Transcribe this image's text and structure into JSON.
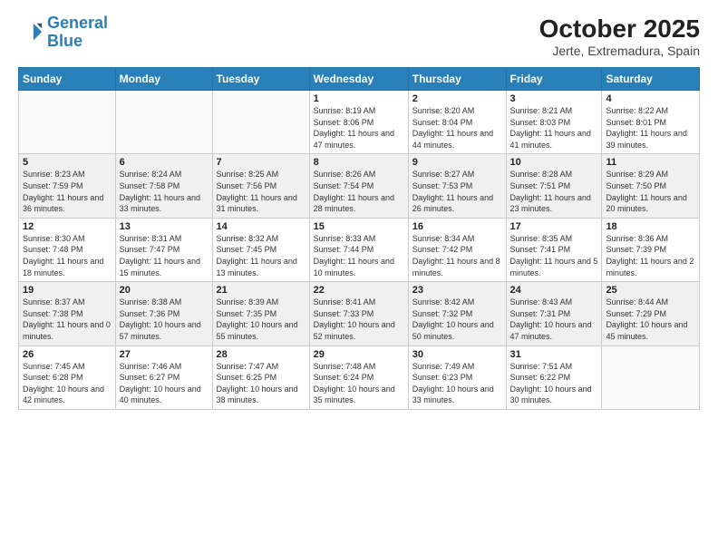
{
  "header": {
    "logo_line1": "General",
    "logo_line2": "Blue",
    "title": "October 2025",
    "subtitle": "Jerte, Extremadura, Spain"
  },
  "weekdays": [
    "Sunday",
    "Monday",
    "Tuesday",
    "Wednesday",
    "Thursday",
    "Friday",
    "Saturday"
  ],
  "weeks": [
    [
      {
        "day": "",
        "info": ""
      },
      {
        "day": "",
        "info": ""
      },
      {
        "day": "",
        "info": ""
      },
      {
        "day": "1",
        "info": "Sunrise: 8:19 AM\nSunset: 8:06 PM\nDaylight: 11 hours and 47 minutes."
      },
      {
        "day": "2",
        "info": "Sunrise: 8:20 AM\nSunset: 8:04 PM\nDaylight: 11 hours and 44 minutes."
      },
      {
        "day": "3",
        "info": "Sunrise: 8:21 AM\nSunset: 8:03 PM\nDaylight: 11 hours and 41 minutes."
      },
      {
        "day": "4",
        "info": "Sunrise: 8:22 AM\nSunset: 8:01 PM\nDaylight: 11 hours and 39 minutes."
      }
    ],
    [
      {
        "day": "5",
        "info": "Sunrise: 8:23 AM\nSunset: 7:59 PM\nDaylight: 11 hours and 36 minutes."
      },
      {
        "day": "6",
        "info": "Sunrise: 8:24 AM\nSunset: 7:58 PM\nDaylight: 11 hours and 33 minutes."
      },
      {
        "day": "7",
        "info": "Sunrise: 8:25 AM\nSunset: 7:56 PM\nDaylight: 11 hours and 31 minutes."
      },
      {
        "day": "8",
        "info": "Sunrise: 8:26 AM\nSunset: 7:54 PM\nDaylight: 11 hours and 28 minutes."
      },
      {
        "day": "9",
        "info": "Sunrise: 8:27 AM\nSunset: 7:53 PM\nDaylight: 11 hours and 26 minutes."
      },
      {
        "day": "10",
        "info": "Sunrise: 8:28 AM\nSunset: 7:51 PM\nDaylight: 11 hours and 23 minutes."
      },
      {
        "day": "11",
        "info": "Sunrise: 8:29 AM\nSunset: 7:50 PM\nDaylight: 11 hours and 20 minutes."
      }
    ],
    [
      {
        "day": "12",
        "info": "Sunrise: 8:30 AM\nSunset: 7:48 PM\nDaylight: 11 hours and 18 minutes."
      },
      {
        "day": "13",
        "info": "Sunrise: 8:31 AM\nSunset: 7:47 PM\nDaylight: 11 hours and 15 minutes."
      },
      {
        "day": "14",
        "info": "Sunrise: 8:32 AM\nSunset: 7:45 PM\nDaylight: 11 hours and 13 minutes."
      },
      {
        "day": "15",
        "info": "Sunrise: 8:33 AM\nSunset: 7:44 PM\nDaylight: 11 hours and 10 minutes."
      },
      {
        "day": "16",
        "info": "Sunrise: 8:34 AM\nSunset: 7:42 PM\nDaylight: 11 hours and 8 minutes."
      },
      {
        "day": "17",
        "info": "Sunrise: 8:35 AM\nSunset: 7:41 PM\nDaylight: 11 hours and 5 minutes."
      },
      {
        "day": "18",
        "info": "Sunrise: 8:36 AM\nSunset: 7:39 PM\nDaylight: 11 hours and 2 minutes."
      }
    ],
    [
      {
        "day": "19",
        "info": "Sunrise: 8:37 AM\nSunset: 7:38 PM\nDaylight: 11 hours and 0 minutes."
      },
      {
        "day": "20",
        "info": "Sunrise: 8:38 AM\nSunset: 7:36 PM\nDaylight: 10 hours and 57 minutes."
      },
      {
        "day": "21",
        "info": "Sunrise: 8:39 AM\nSunset: 7:35 PM\nDaylight: 10 hours and 55 minutes."
      },
      {
        "day": "22",
        "info": "Sunrise: 8:41 AM\nSunset: 7:33 PM\nDaylight: 10 hours and 52 minutes."
      },
      {
        "day": "23",
        "info": "Sunrise: 8:42 AM\nSunset: 7:32 PM\nDaylight: 10 hours and 50 minutes."
      },
      {
        "day": "24",
        "info": "Sunrise: 8:43 AM\nSunset: 7:31 PM\nDaylight: 10 hours and 47 minutes."
      },
      {
        "day": "25",
        "info": "Sunrise: 8:44 AM\nSunset: 7:29 PM\nDaylight: 10 hours and 45 minutes."
      }
    ],
    [
      {
        "day": "26",
        "info": "Sunrise: 7:45 AM\nSunset: 6:28 PM\nDaylight: 10 hours and 42 minutes."
      },
      {
        "day": "27",
        "info": "Sunrise: 7:46 AM\nSunset: 6:27 PM\nDaylight: 10 hours and 40 minutes."
      },
      {
        "day": "28",
        "info": "Sunrise: 7:47 AM\nSunset: 6:25 PM\nDaylight: 10 hours and 38 minutes."
      },
      {
        "day": "29",
        "info": "Sunrise: 7:48 AM\nSunset: 6:24 PM\nDaylight: 10 hours and 35 minutes."
      },
      {
        "day": "30",
        "info": "Sunrise: 7:49 AM\nSunset: 6:23 PM\nDaylight: 10 hours and 33 minutes."
      },
      {
        "day": "31",
        "info": "Sunrise: 7:51 AM\nSunset: 6:22 PM\nDaylight: 10 hours and 30 minutes."
      },
      {
        "day": "",
        "info": ""
      }
    ]
  ]
}
